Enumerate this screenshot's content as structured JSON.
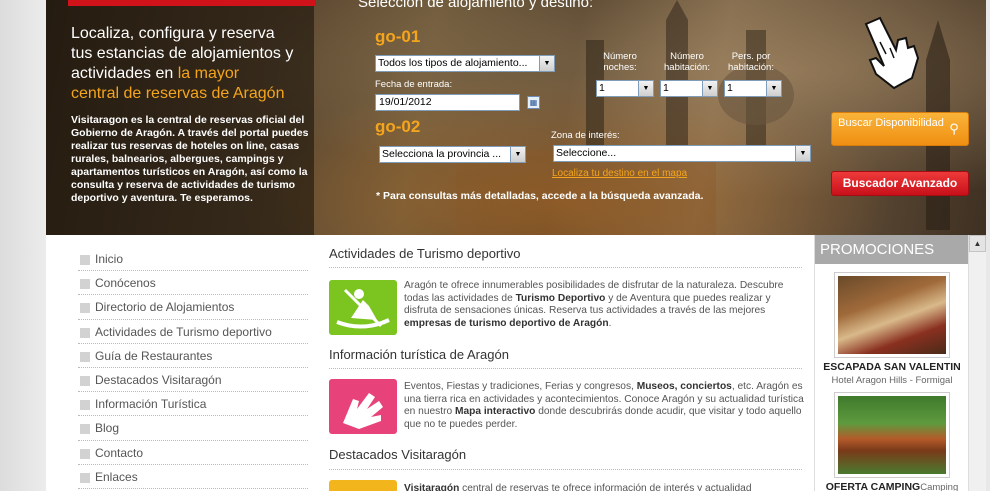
{
  "hero": {
    "heading_line1": "Localiza, configura y reserva",
    "heading_line2": "tus estancias de alojamientos y",
    "heading_line3a": "actividades en ",
    "heading_line3b": "la mayor",
    "heading_line4": "central de reservas de Aragón",
    "description": "Visitaragon es la central de reservas oficial del Gobierno de Aragón. A través del portal puedes realizar tus reservas de hoteles on line, casas rurales, balnearios, albergues, campings y apartamentos turísticos en Aragón, así como la consulta y reserva de actividades de turismo deportivo y aventura. Te esperamos.",
    "form_title": "Selección de alojamiento y destino:",
    "go01": "go-01",
    "go02": "go-02",
    "tipo_alojamiento": "Todos los tipos de alojamiento...",
    "fecha_label": "Fecha de entrada:",
    "fecha_value": "19/01/2012",
    "noches_label": "Número noches:",
    "habitacion_label": "Número habitación:",
    "pers_label": "Pers. por habitación:",
    "noches_value": "1",
    "habitacion_value": "1",
    "pers_value": "1",
    "provincia": "Selecciona la provincia ...",
    "zona_label": "Zona de interés:",
    "zona_value": "Seleccione...",
    "map_link": "Localiza tu destino en el mapa",
    "note": "* Para consultas más detalladas, accede a la búsqueda avanzada.",
    "btn_buscar": "Buscar Disponibilidad",
    "btn_avanzado": "Buscador Avanzado"
  },
  "sidebar": {
    "items": [
      {
        "label": "Inicio"
      },
      {
        "label": "Conócenos"
      },
      {
        "label": "Directorio de Alojamientos"
      },
      {
        "label": "Actividades de Turismo deportivo"
      },
      {
        "label": "Guía de Restaurantes"
      },
      {
        "label": "Destacados Visitaragón"
      },
      {
        "label": "Información Turística"
      },
      {
        "label": "Blog"
      },
      {
        "label": "Contacto"
      },
      {
        "label": "Enlaces"
      }
    ]
  },
  "main": {
    "sections": [
      {
        "title": "Actividades de Turismo deportivo",
        "text_a": "Aragón te ofrece innumerables posibilidades de disfrutar de la naturaleza. Descubre todas las actividades de ",
        "bold_a": "Turismo Deportivo",
        "text_b": " y de Aventura que puedes realizar y disfruta de sensaciones únicas. Reserva tus actividades a través de las mejores ",
        "bold_b": "empresas de turismo deportivo de Aragón",
        "text_c": "."
      },
      {
        "title": "Información turística de Aragón",
        "text_a": "Eventos, Fiestas y tradiciones, Ferias y congresos, ",
        "bold_a": "Museos, conciertos",
        "text_b": ", etc. Aragón es una tierra rica en actividades y acontecimientos. Conoce Aragón y su actualidad turística en nuestro ",
        "bold_b": "Mapa interactivo",
        "text_c": " donde descubrirás donde acudir, que visitar y todo aquello que no te puedes perder."
      },
      {
        "title": "Destacados Visitaragón",
        "bold_a": "Visitaragón",
        "text_a": " central de reservas te ofrece información de interés y actualidad"
      }
    ]
  },
  "promos": {
    "header": "PROMOCIONES",
    "items": [
      {
        "title": "ESCAPADA SAN VALENTIN",
        "subtitle": "Hotel Aragon Hills - Formigal"
      },
      {
        "title": "OFERTA CAMPING",
        "subtitle": "Camping"
      }
    ]
  },
  "colors": {
    "accent_orange": "#f5a51c",
    "brand_red": "#d0131b",
    "promo_header": "#a9a9a9"
  }
}
